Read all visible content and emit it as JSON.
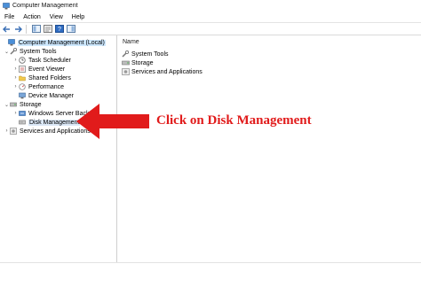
{
  "window": {
    "title": "Computer Management"
  },
  "menu": [
    "File",
    "Action",
    "View",
    "Help"
  ],
  "toolbar": [
    "back-icon",
    "forward-icon",
    "show-tree-icon",
    "properties-icon",
    "help-icon",
    "action-pane-icon"
  ],
  "tree": {
    "root": "Computer Management (Local)",
    "system_tools": "System Tools",
    "task_scheduler": "Task Scheduler",
    "event_viewer": "Event Viewer",
    "shared_folders": "Shared Folders",
    "performance": "Performance",
    "device_manager": "Device Manager",
    "storage": "Storage",
    "windows_server_backup": "Windows Server Backup",
    "disk_management": "Disk Management",
    "services_apps": "Services and Applications"
  },
  "content": {
    "column_name": "Name",
    "items": [
      "System Tools",
      "Storage",
      "Services and Applications"
    ]
  },
  "annotation": {
    "text": "Click on Disk Management",
    "color": "#e11b1b"
  },
  "colors": {
    "selection": "#cde8ff",
    "accent": "#e11b1b"
  }
}
